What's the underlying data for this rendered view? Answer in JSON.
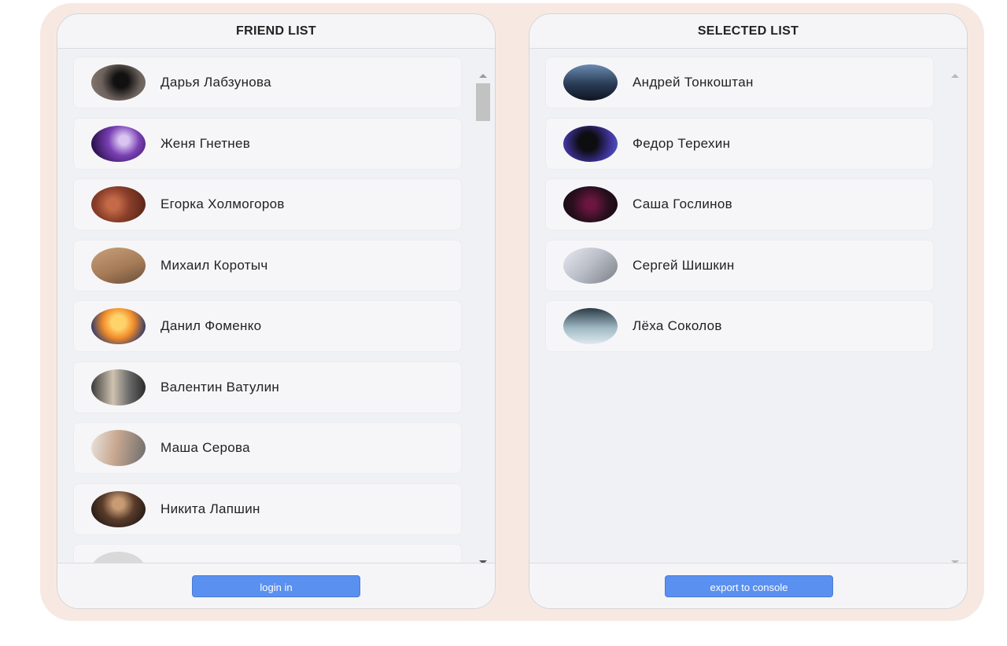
{
  "friend_panel": {
    "title": "FRIEND LIST",
    "friends": [
      {
        "name": "Дарья Лабзунова",
        "avatar": "av-dasha"
      },
      {
        "name": "Женя Гнетнев",
        "avatar": "av-zhenya"
      },
      {
        "name": "Егорка Холмогоров",
        "avatar": "av-egorka"
      },
      {
        "name": "Михаил Коротыч",
        "avatar": "av-mikhail"
      },
      {
        "name": "Данил Фоменко",
        "avatar": "av-danil"
      },
      {
        "name": "Валентин Ватулин",
        "avatar": "av-valentin"
      },
      {
        "name": "Маша Серова",
        "avatar": "av-masha"
      },
      {
        "name": "Никита Лапшин",
        "avatar": "av-nikita"
      },
      {
        "name": "",
        "avatar": "av-next"
      }
    ],
    "button_label": "login in"
  },
  "selected_panel": {
    "title": "SELECTED LIST",
    "friends": [
      {
        "name": "Андрей Тонкоштан",
        "avatar": "av-andrey"
      },
      {
        "name": "Федор Терехин",
        "avatar": "av-fedor"
      },
      {
        "name": "Саша Гослинов",
        "avatar": "av-sasha"
      },
      {
        "name": "Сергей Шишкин",
        "avatar": "av-sergey"
      },
      {
        "name": "Лёха Соколов",
        "avatar": "av-lekha"
      }
    ],
    "button_label": "export to console"
  },
  "colors": {
    "frame_background": "#f7e9e2",
    "panel_background": "#f0f1f4",
    "button_blue": "#5a90f0"
  },
  "icons": {
    "scroll_up": "scroll-up-arrow-icon",
    "scroll_down": "scroll-down-arrow-icon",
    "avatar": "user-avatar-icon"
  }
}
